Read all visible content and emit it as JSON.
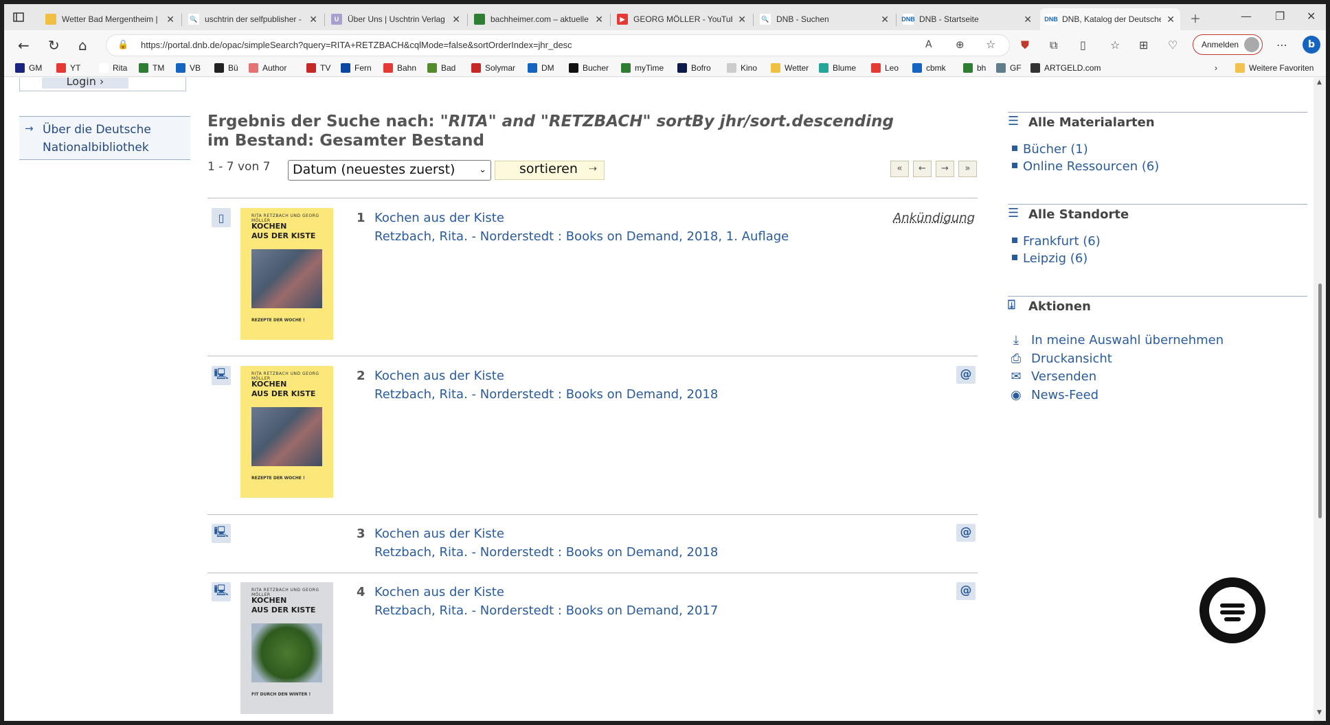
{
  "browser": {
    "tabs": [
      {
        "title": "Wetter Bad Mergentheim |",
        "fav_color": "#f0c040",
        "fav_glyph": ""
      },
      {
        "title": "uschtrin der selfpublisher -",
        "fav_color": "#ffffff",
        "fav_glyph": "🔍"
      },
      {
        "title": "Über Uns | Uschtrin Verlag",
        "fav_color": "#a9a0d0",
        "fav_glyph": "U"
      },
      {
        "title": "bachheimer.com – aktuelle",
        "fav_color": "#2e7d32",
        "fav_glyph": ""
      },
      {
        "title": "GEORG MÖLLER - YouTube",
        "fav_color": "#e53935",
        "fav_glyph": "▶"
      },
      {
        "title": "DNB - Suchen",
        "fav_color": "#ffffff",
        "fav_glyph": "🔍"
      },
      {
        "title": "DNB - Startseite",
        "fav_color": "#ffffff",
        "fav_glyph": "DNB"
      },
      {
        "title": "DNB, Katalog der Deutsche",
        "fav_color": "#ffffff",
        "fav_glyph": "DNB",
        "active": true
      }
    ],
    "url": "https://portal.dnb.de/opac/simpleSearch?query=RITA+RETZBACH&cqlMode=false&sortOrderIndex=jhr_desc",
    "signin_label": "Anmelden",
    "favorites": [
      {
        "label": "GM",
        "color": "#1a237e"
      },
      {
        "label": "YT",
        "color": "#e53935"
      },
      {
        "label": "Rita",
        "color": "#ffffff"
      },
      {
        "label": "TM",
        "color": "#2e7d32"
      },
      {
        "label": "VB",
        "color": "#1565c0"
      },
      {
        "label": "Bü",
        "color": "#222222"
      },
      {
        "label": "Author",
        "color": "#e57373"
      },
      {
        "label": "TV",
        "color": "#c62828"
      },
      {
        "label": "Fern",
        "color": "#0d47a1"
      },
      {
        "label": "Bahn",
        "color": "#e53935"
      },
      {
        "label": "Bad",
        "color": "#558b2f"
      },
      {
        "label": "Solymar",
        "color": "#c62828"
      },
      {
        "label": "DM",
        "color": "#1565c0"
      },
      {
        "label": "Bucher",
        "color": "#111111"
      },
      {
        "label": "myTime",
        "color": "#2e7d32"
      },
      {
        "label": "Bofro",
        "color": "#0d1b4a"
      },
      {
        "label": "Kino",
        "color": "#cccccc"
      },
      {
        "label": "Wetter",
        "color": "#f0c040"
      },
      {
        "label": "Blume",
        "color": "#26a69a"
      },
      {
        "label": "Leo",
        "color": "#e53935"
      },
      {
        "label": "cbmk",
        "color": "#1565c0"
      },
      {
        "label": "bh",
        "color": "#2e7d32"
      },
      {
        "label": "GF",
        "color": "#607d8b"
      },
      {
        "label": "ARTGELD.com",
        "color": "#333333"
      }
    ],
    "more_favorites": "Weitere Favoriten"
  },
  "sidebar_left": {
    "login_label": "Login",
    "about_label": "Über die Deutsche Nationalbibliothek"
  },
  "results": {
    "headline_prefix": "Ergebnis der Suche nach: ",
    "headline_query": "\"RITA\" and \"RETZBACH\" sortBy jhr/sort.descending",
    "headline_line2": "im Bestand: Gesamter Bestand",
    "count_text": "1 - 7 von 7",
    "sort_value": "Datum (neuestes zuerst)",
    "sort_button": "sortieren",
    "items": [
      {
        "num": "1",
        "title": "Kochen aus der Kiste",
        "sub": "Retzbach, Rita. - Norderstedt : Books on Demand, 2018, 1. Auflage",
        "status": "Ankündigung",
        "cover": "yellow"
      },
      {
        "num": "2",
        "title": "Kochen aus der Kiste",
        "sub": "Retzbach, Rita. - Norderstedt : Books on Demand, 2018",
        "badge": "@",
        "cover": "yellow"
      },
      {
        "num": "3",
        "title": "Kochen aus der Kiste",
        "sub": "Retzbach, Rita. - Norderstedt : Books on Demand, 2018",
        "badge": "@"
      },
      {
        "num": "4",
        "title": "Kochen aus der Kiste",
        "sub": "Retzbach, Rita. - Norderstedt : Books on Demand, 2017",
        "badge": "@",
        "cover": "grey"
      }
    ],
    "cover_text": {
      "authors": "RITA RETZBACH UND GEORG MÖLLER",
      "title_line1": "KOCHEN",
      "title_line2": "AUS DER KISTE",
      "yellow_footer": "REZEPTE DER WOCHE !",
      "grey_footer": "FIT DURCH DEN WINTER !"
    }
  },
  "sidebar_right": {
    "materials_header": "Alle Materialarten",
    "materials": [
      "Bücher (1)",
      "Online Ressourcen (6)"
    ],
    "locations_header": "Alle Standorte",
    "locations": [
      "Frankfurt (6)",
      "Leipzig (6)"
    ],
    "actions_header": "Aktionen",
    "actions": [
      {
        "label": "In meine Auswahl übernehmen",
        "icon": "download-tray-icon"
      },
      {
        "label": "Druckansicht",
        "icon": "printer-icon"
      },
      {
        "label": "Versenden",
        "icon": "envelope-icon"
      },
      {
        "label": "News-Feed",
        "icon": "rss-icon"
      }
    ]
  }
}
